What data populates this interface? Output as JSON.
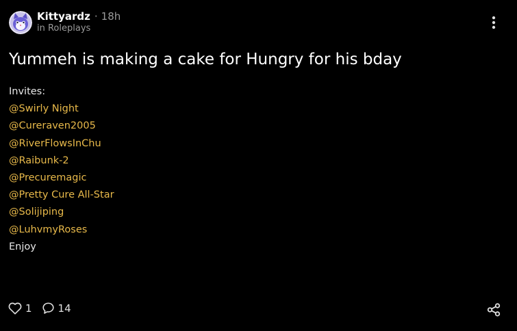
{
  "post": {
    "author": "Kittyardz",
    "separator": "·",
    "time_ago": "18h",
    "community": "in Roleplays",
    "title": "Yummeh is making a cake for Hungry for his bday",
    "invites_label": "Invites:",
    "mentions": [
      "@Swirly Night",
      "@Cureraven2005",
      "@RiverFlowsInChu",
      "@Raibunk-2",
      "@Precuremagic",
      "@Pretty Cure All-Star",
      "@Solijiping",
      "@LuhvmyRoses"
    ],
    "closing": "Enjoy"
  },
  "footer": {
    "like_count": "1",
    "comment_count": "14"
  },
  "icons": {
    "avatar": "avatar-cat-icon",
    "more": "more-vertical-icon",
    "like": "heart-icon",
    "comment": "comment-bubble-icon",
    "share": "share-icon"
  },
  "colors": {
    "background": "#000000",
    "text": "#ffffff",
    "muted": "#9a9a9a",
    "mention": "#e8b94a"
  }
}
